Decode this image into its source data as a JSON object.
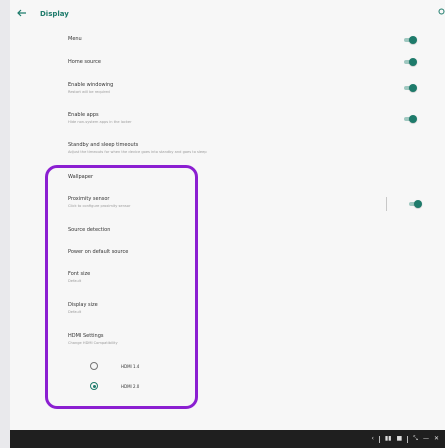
{
  "header": {
    "title": "Display"
  },
  "settings": [
    {
      "label": "Menu",
      "sub": "",
      "toggle": true
    },
    {
      "label": "Home source",
      "sub": "",
      "toggle": true
    },
    {
      "label": "Enable windowing",
      "sub": "Restart will be required",
      "toggle": true
    },
    {
      "label": "Enable apps",
      "sub": "Hide non-system apps in the locker",
      "toggle": true
    },
    {
      "label": "Standby and sleep timeouts",
      "sub": "Adjust the timeouts for when the device goes into standby and goes to sleep",
      "toggle": false
    },
    {
      "label": "Wallpaper",
      "sub": "",
      "toggle": false
    },
    {
      "label": "Proximity sensor",
      "sub": "Click to configure proximity sensor",
      "toggle": true
    },
    {
      "label": "Source detection",
      "sub": "",
      "toggle": false
    },
    {
      "label": "Power on default source",
      "sub": "",
      "toggle": false
    },
    {
      "label": "Font size",
      "sub": "Default",
      "toggle": false
    },
    {
      "label": "Display size",
      "sub": "Default",
      "toggle": false
    },
    {
      "label": "HDMI Settings",
      "sub": "Change HDMI Compatibility",
      "toggle": false
    }
  ],
  "hdmi_options": [
    {
      "label": "HDMI 1.4",
      "selected": false
    },
    {
      "label": "HDMI 2.0",
      "selected": true
    }
  ],
  "navbar": {
    "icons": [
      "back-icon",
      "app-switch-icon",
      "window-icon",
      "expand-icon",
      "minimize-icon",
      "close-icon"
    ]
  },
  "colors": {
    "accent": "#1e7b6b",
    "highlight": "#8b1fd1",
    "navbar": "#1f1f1f"
  }
}
